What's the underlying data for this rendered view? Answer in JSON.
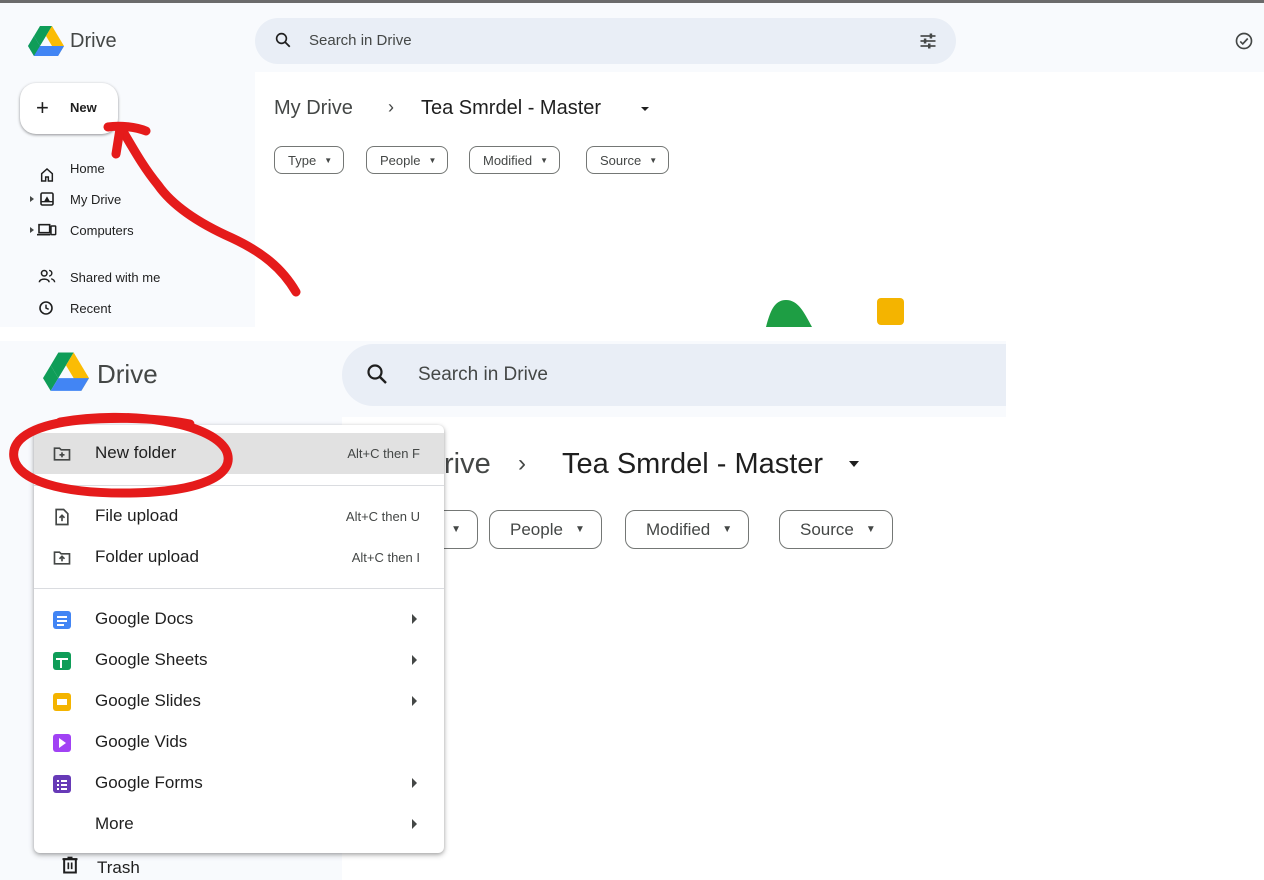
{
  "app": {
    "name": "Drive"
  },
  "search": {
    "placeholder": "Search in Drive"
  },
  "new_button": {
    "label": "New"
  },
  "sidebar": {
    "items": [
      {
        "label": "Home",
        "icon": "home-icon"
      },
      {
        "label": "My Drive",
        "icon": "my-drive-icon"
      },
      {
        "label": "Computers",
        "icon": "computers-icon"
      },
      {
        "label": "Shared with me",
        "icon": "shared-icon"
      },
      {
        "label": "Recent",
        "icon": "recent-icon"
      }
    ],
    "trash": "Trash"
  },
  "breadcrumb": {
    "root": "My Drive",
    "separator": "›",
    "current": "Tea Smrdel - Master",
    "root_partial": "rive"
  },
  "filters": [
    "Type",
    "People",
    "Modified",
    "Source"
  ],
  "new_menu": {
    "items": [
      {
        "label": "New folder",
        "shortcut": "Alt+C then F",
        "icon": "new-folder-icon",
        "highlighted": true
      },
      {
        "label": "File upload",
        "shortcut": "Alt+C then U",
        "icon": "file-upload-icon"
      },
      {
        "label": "Folder upload",
        "shortcut": "Alt+C then I",
        "icon": "folder-upload-icon"
      },
      {
        "label": "Google Docs",
        "icon": "google-docs-icon",
        "submenu": true
      },
      {
        "label": "Google Sheets",
        "icon": "google-sheets-icon",
        "submenu": true
      },
      {
        "label": "Google Slides",
        "icon": "google-slides-icon",
        "submenu": true
      },
      {
        "label": "Google Vids",
        "icon": "google-vids-icon"
      },
      {
        "label": "Google Forms",
        "icon": "google-forms-icon",
        "submenu": true
      },
      {
        "label": "More",
        "submenu": true
      }
    ]
  },
  "colors": {
    "annotation": "#e51b1b",
    "sidebar_bg": "#f8fafd",
    "search_bg": "#e9eef6",
    "docs": "#4285f4",
    "sheets": "#0f9d58",
    "slides": "#f4b400",
    "vids": "#a142f4",
    "forms": "#673ab7"
  }
}
